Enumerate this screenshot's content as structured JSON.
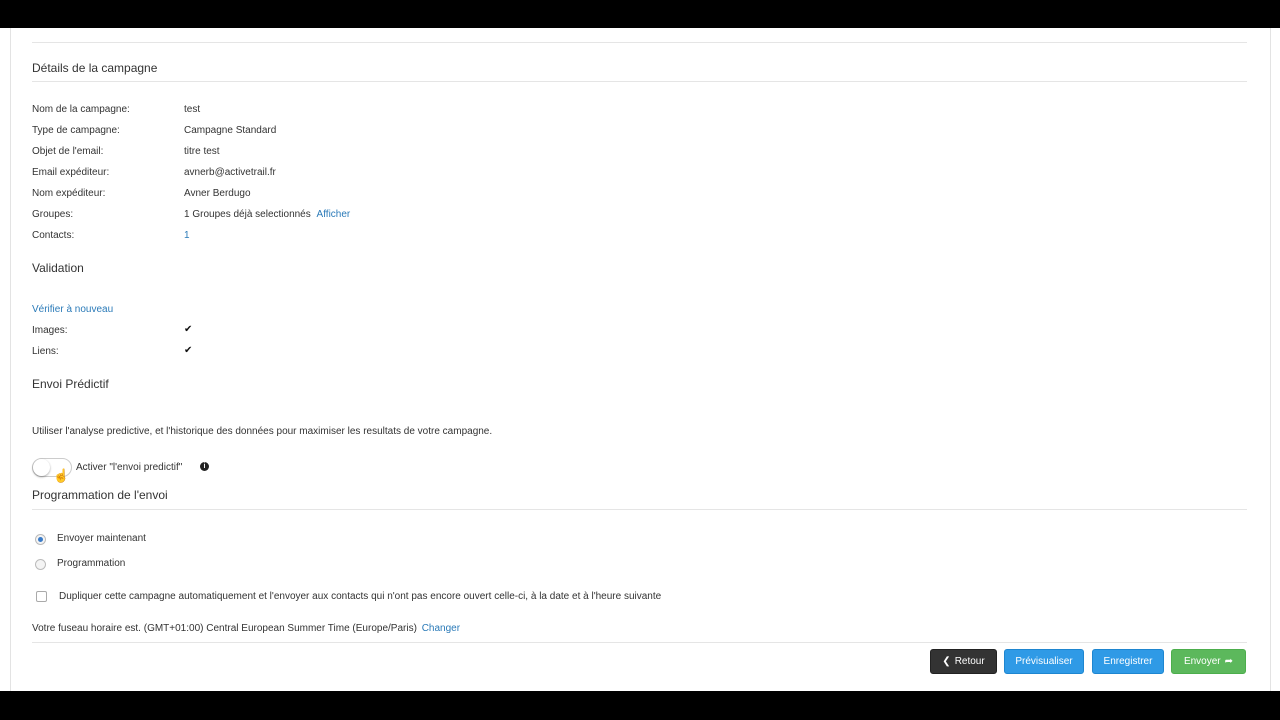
{
  "details": {
    "heading": "Détails de la campagne",
    "rows": [
      {
        "label": "Nom de la campagne:",
        "value": "test"
      },
      {
        "label": "Type de campagne:",
        "value": "Campagne Standard"
      },
      {
        "label": "Objet de l'email:",
        "value": "titre test"
      },
      {
        "label": "Email expéditeur:",
        "value": "avnerb@activetrail.fr"
      },
      {
        "label": "Nom expéditeur:",
        "value": "Avner Berdugo"
      }
    ],
    "groups_label": "Groupes:",
    "groups_value": "1 Groupes déjà selectionnés",
    "groups_link": "Afficher",
    "contacts_label": "Contacts:",
    "contacts_value": "1"
  },
  "validation": {
    "heading": "Validation",
    "recheck_link": "Vérifier à nouveau",
    "images_label": "Images:",
    "links_label": "Liens:",
    "check_glyph": "✔"
  },
  "predictive": {
    "heading": "Envoi Prédictif",
    "description": "Utiliser l'analyse predictive, et l'historique des données pour maximiser les resultats de votre campagne.",
    "toggle_label": "Activer \"l'envoi predictif\"",
    "toggle_on": false,
    "info_glyph": "i"
  },
  "schedule": {
    "heading": "Programmation de l'envoi",
    "option_now": "Envoyer maintenant",
    "option_schedule": "Programmation",
    "selected": "now",
    "duplicate_label": "Dupliquer cette campagne automatiquement et l'envoyer aux contacts qui n'ont pas encore ouvert celle-ci, à la date et à l'heure suivante",
    "timezone_text": "Votre fuseau horaire est. (GMT+01:00) Central European Summer Time (Europe/Paris)",
    "timezone_link": "Changer"
  },
  "actions": {
    "back": "Retour",
    "back_icon": "chevron-left-icon",
    "preview": "Prévisualiser",
    "save": "Enregistrer",
    "send": "Envoyer",
    "send_icon": "share-arrow-icon"
  },
  "colors": {
    "link": "#2a7ab8",
    "primary": "#2f9ae6",
    "success": "#5cb85c",
    "dark": "#333333"
  }
}
